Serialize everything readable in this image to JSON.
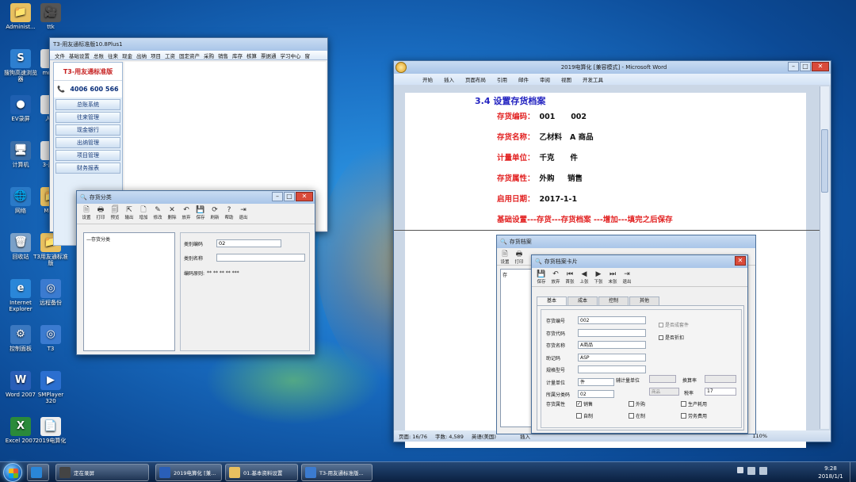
{
  "desktop": {
    "icons": [
      {
        "label": "Administ...",
        "color": "#e8c060",
        "glyph": "📁"
      },
      {
        "label": "ttk",
        "color": "#555555",
        "glyph": "🎥"
      },
      {
        "label": "搜狗高速浏览器",
        "color": "#2d7fd0",
        "glyph": "S"
      },
      {
        "label": "mcs...",
        "color": "#dddddd",
        "glyph": ""
      },
      {
        "label": "EV录屏",
        "color": "#1e5fb0",
        "glyph": "●"
      },
      {
        "label": "人...",
        "color": "#dddddd",
        "glyph": ""
      },
      {
        "label": "计算机",
        "color": "#3a6ea8",
        "glyph": "🖥"
      },
      {
        "label": "3-用...",
        "color": "#dddddd",
        "glyph": ""
      },
      {
        "label": "网络",
        "color": "#2a7ac8",
        "glyph": "🌐"
      },
      {
        "label": "MS...",
        "color": "#e8c060",
        "glyph": "📁"
      },
      {
        "label": "回收站",
        "color": "#7aa0c8",
        "glyph": "🗑"
      },
      {
        "label": "T3用友通标准版",
        "color": "#e8c060",
        "glyph": "📁"
      },
      {
        "label": "Internet Explorer",
        "color": "#2a86d8",
        "glyph": "e"
      },
      {
        "label": "远程备份",
        "color": "#3b7bd0",
        "glyph": "◎"
      },
      {
        "label": "控制面板",
        "color": "#3b78c0",
        "glyph": "⚙"
      },
      {
        "label": "T3",
        "color": "#3b7bd0",
        "glyph": "◎"
      },
      {
        "label": "Word 2007",
        "color": "#2a5fb8",
        "glyph": "W"
      },
      {
        "label": "SMPlayer 320",
        "color": "#2b6fd0",
        "glyph": "▶"
      },
      {
        "label": "Excel 2007",
        "color": "#2a8a3a",
        "glyph": "X"
      },
      {
        "label": "2019电算化",
        "color": "#eeeeee",
        "glyph": "📄"
      }
    ]
  },
  "t3_window": {
    "title": "T3-用友通标准版10.8Plus1",
    "menu": [
      "文件",
      "基础设置",
      "总账",
      "往来",
      "现金",
      "出纳",
      "项目",
      "工资",
      "固定资产",
      "采购",
      "销售",
      "库存",
      "核算",
      "票据通",
      "学习中心",
      "窗"
    ],
    "logo": "T3-用友通标准版",
    "phone": "4006 600 566",
    "nav": [
      "总账系统",
      "往来管理",
      "现金银行",
      "出纳管理",
      "项目管理",
      "财务报表"
    ]
  },
  "inventory_class_dialog": {
    "title": "存货分类",
    "toolbar": [
      "设置",
      "打印",
      "预览",
      "输出",
      "增加",
      "修改",
      "删除",
      "放弃",
      "保存",
      "刷新",
      "帮助",
      "退出"
    ],
    "tree_root": "存货分类",
    "fields": {
      "code_label": "类别编码",
      "code_value": "02",
      "name_label": "类别名称",
      "name_value": "",
      "rule_label": "编码原则:",
      "rule_value": "** ** ** ** ***"
    }
  },
  "word_window": {
    "title": "2019电算化 [兼容模式] - Microsoft Word",
    "ribbon_tabs": [
      "开始",
      "插入",
      "页面布局",
      "引用",
      "邮件",
      "审阅",
      "视图",
      "开发工具"
    ],
    "doc": {
      "heading": "3.4 设置存货档案",
      "lines": [
        {
          "label": "存货编码：",
          "value": "001      002"
        },
        {
          "label": "存货名称：",
          "value": "乙材料   A 商品"
        },
        {
          "label": "计量单位：",
          "value": "千克      件"
        },
        {
          "label": "存货属性：",
          "value": "外购     销售"
        },
        {
          "label": "启用日期：",
          "value": "2017-1-1"
        }
      ],
      "instruction": "基础设置---存货---存货档案  ---增加---填完之后保存"
    },
    "statusbar": {
      "page": "页面: 16/76",
      "words": "字数: 4,589",
      "lang": "英语(美国)",
      "mode": "插入",
      "zoom": "110%"
    }
  },
  "embedded_archive": {
    "title": "存货档案",
    "toolbar": [
      "设置",
      "打印"
    ],
    "tree_items": [
      "存"
    ]
  },
  "archive_card": {
    "title": "存货档案卡片",
    "toolbar": [
      "保存",
      "放弃",
      "首张",
      "上张",
      "下张",
      "末张",
      "退出"
    ],
    "tabs": [
      "基本",
      "成本",
      "控制",
      "其他"
    ],
    "fields": [
      {
        "label": "存货编号",
        "value": "002"
      },
      {
        "label": "存货代码",
        "value": ""
      },
      {
        "label": "存货名称",
        "value": "A商品"
      },
      {
        "label": "助记码",
        "value": "ASP"
      },
      {
        "label": "规格型号",
        "value": ""
      },
      {
        "label": "计量单位",
        "value": "件"
      },
      {
        "label": "所属分类码",
        "value": "02"
      }
    ],
    "aux_unit_label": "辅计量单位",
    "rate_label": "换算率",
    "tax_label": "税率",
    "tax_value": "17",
    "class_hint": "商品",
    "checks_right": [
      "是否成套件",
      "是否折扣"
    ],
    "attr_label": "存货属性",
    "attrs": [
      {
        "label": "销售",
        "checked": true
      },
      {
        "label": "外购",
        "checked": false
      },
      {
        "label": "生产耗用",
        "checked": false
      },
      {
        "label": "自制",
        "checked": false
      },
      {
        "label": "在制",
        "checked": false
      },
      {
        "label": "劳务费用",
        "checked": false
      }
    ]
  },
  "taskbar": {
    "items": [
      {
        "label": "",
        "color": "#2a86d8"
      },
      {
        "label": "",
        "color": "#2d7fd0"
      },
      {
        "label": "定在录屏",
        "color": "#444444"
      },
      {
        "label": "2019电算化 [兼...",
        "color": "#2a5fb8"
      },
      {
        "label": "01.基本资料设置",
        "color": "#e8c060"
      },
      {
        "label": "T3-用友通标准版...",
        "color": "#3b7bd0"
      }
    ],
    "time": "9:28",
    "date": "2018/1/1"
  }
}
